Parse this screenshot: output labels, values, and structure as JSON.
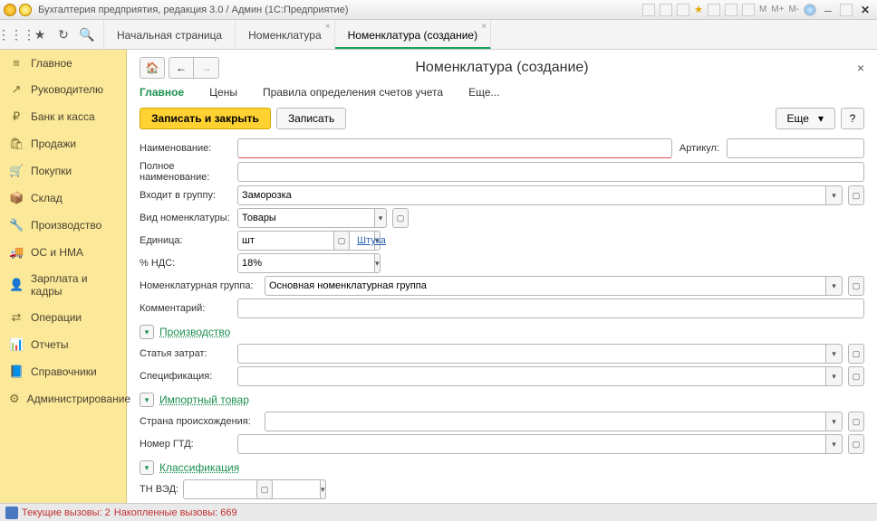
{
  "titlebar": {
    "title": "Бухгалтерия предприятия, редакция 3.0 / Админ  (1С:Предприятие)",
    "m1": "M",
    "m2": "M+",
    "m3": "M-"
  },
  "tabs": {
    "t0": "Начальная страница",
    "t1": "Номенклатура",
    "t2": "Номенклатура (создание)"
  },
  "sidebar": {
    "items": [
      {
        "icon": "≡",
        "label": "Главное"
      },
      {
        "icon": "↗",
        "label": "Руководителю"
      },
      {
        "icon": "₽",
        "label": "Банк и касса"
      },
      {
        "icon": "🛍",
        "label": "Продажи"
      },
      {
        "icon": "🛒",
        "label": "Покупки"
      },
      {
        "icon": "📦",
        "label": "Склад"
      },
      {
        "icon": "🔧",
        "label": "Производство"
      },
      {
        "icon": "🚚",
        "label": "ОС и НМА"
      },
      {
        "icon": "👤",
        "label": "Зарплата и кадры"
      },
      {
        "icon": "⇄",
        "label": "Операции"
      },
      {
        "icon": "📊",
        "label": "Отчеты"
      },
      {
        "icon": "📘",
        "label": "Справочники"
      },
      {
        "icon": "⚙",
        "label": "Администрирование"
      }
    ]
  },
  "page": {
    "title": "Номенклатура (создание)",
    "subtabs": {
      "t0": "Главное",
      "t1": "Цены",
      "t2": "Правила определения счетов учета",
      "t3": "Еще..."
    },
    "toolbar": {
      "save_close": "Записать и закрыть",
      "save": "Записать",
      "more": "Еще",
      "help": "?"
    },
    "labels": {
      "name": "Наименование:",
      "article": "Артикул:",
      "fullname": "Полное наименование:",
      "group": "Входит в группу:",
      "type": "Вид номенклатуры:",
      "unit": "Единица:",
      "unit_link": "Штука",
      "vat": "% НДС:",
      "nmgroup": "Номенклатурная группа:",
      "comment": "Комментарий:",
      "costitem": "Статья затрат:",
      "spec": "Спецификация:",
      "origin": "Страна происхождения:",
      "gtd": "Номер ГТД:",
      "tnved": "ТН ВЭД:"
    },
    "values": {
      "group": "Заморозка",
      "type": "Товары",
      "unit": "шт",
      "vat": "18%",
      "nmgroup": "Основная номенклатурная группа"
    },
    "sections": {
      "prod": "Производство",
      "import": "Импортный товар",
      "class": "Классификация"
    }
  },
  "status": {
    "calls": "Текущие вызовы: 2",
    "accum": "Накопленные вызовы: 669"
  }
}
